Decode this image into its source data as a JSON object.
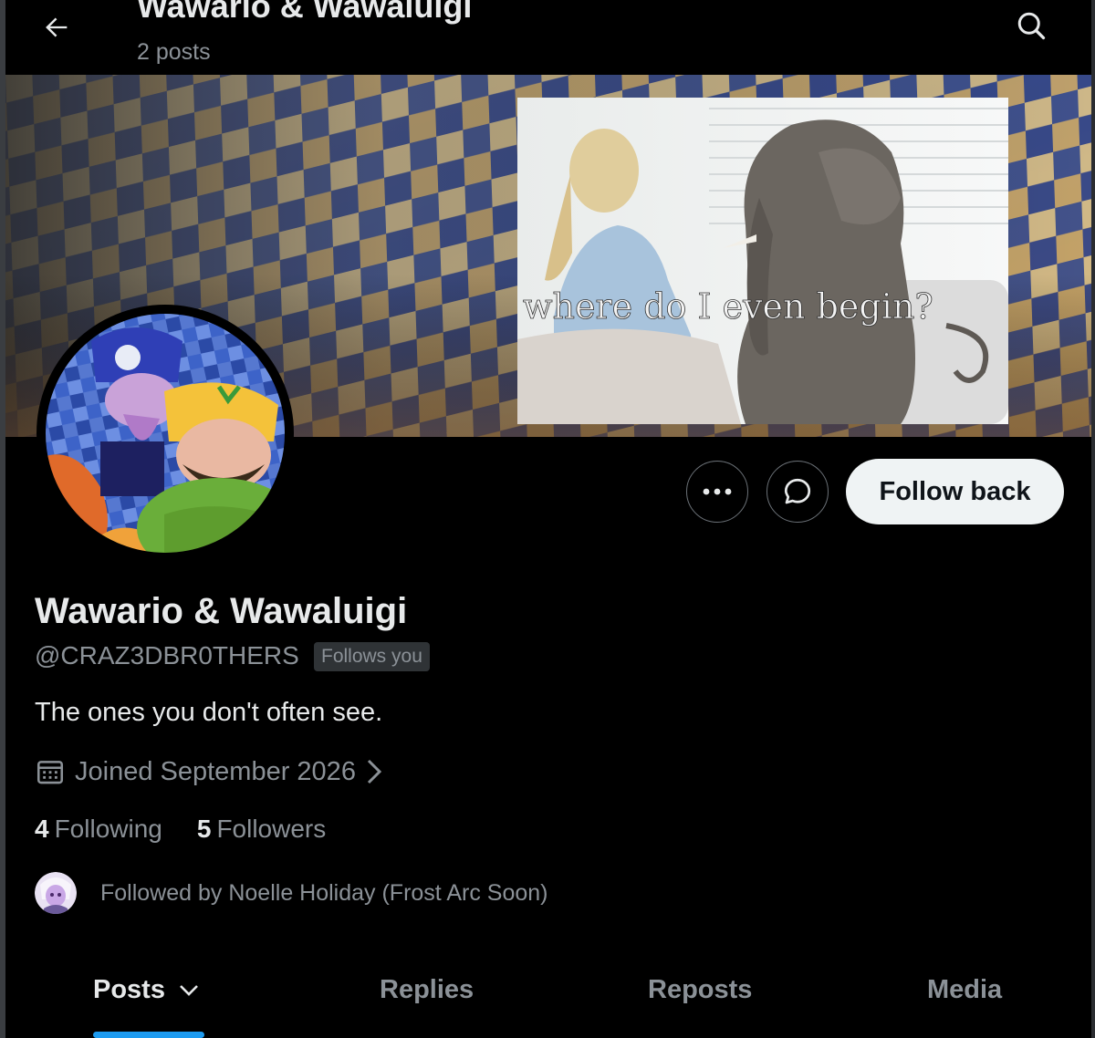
{
  "header": {
    "title": "Wawario & Wawaluigi",
    "post_count": "2 posts"
  },
  "banner": {
    "meme_caption": "where do I even begin?"
  },
  "actions": {
    "follow_label": "Follow back"
  },
  "profile": {
    "display_name": "Wawario & Wawaluigi",
    "handle": "@CRAZ3DBR0THERS",
    "follows_you_badge": "Follows you",
    "bio": "The ones you don't often see.",
    "joined": "Joined September 2026",
    "following_count": "4",
    "following_label": "Following",
    "followers_count": "5",
    "followers_label": "Followers",
    "followed_by": "Followed by Noelle Holiday (Frost Arc Soon)"
  },
  "tabs": [
    {
      "label": "Posts",
      "active": true
    },
    {
      "label": "Replies",
      "active": false
    },
    {
      "label": "Reposts",
      "active": false
    },
    {
      "label": "Media",
      "active": false
    }
  ],
  "colors": {
    "accent": "#1d9bf0",
    "background": "#000000",
    "secondary_text": "#8b9197"
  },
  "icons": [
    "back-arrow-icon",
    "search-icon",
    "more-dots-icon",
    "message-icon",
    "calendar-icon",
    "chevron-right-icon",
    "chevron-down-icon"
  ]
}
